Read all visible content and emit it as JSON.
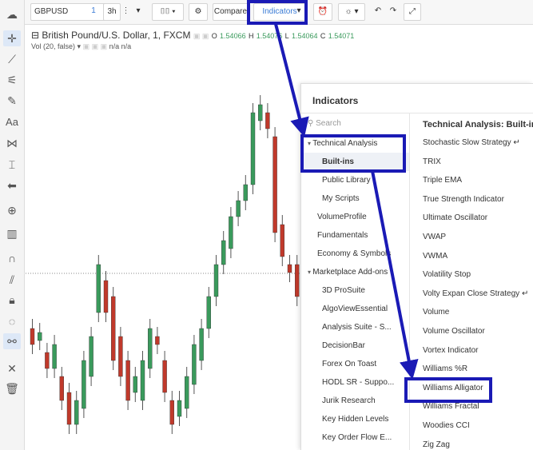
{
  "toolbar": {
    "symbol": "GBPUSD",
    "interval_1": "1",
    "interval_3h": "3h",
    "compare": "Compare",
    "indicators": "Indicators"
  },
  "chart": {
    "legend_title": "British Pound/U.S. Dollar, 1, FXCM",
    "o_label": "O",
    "o_value": "1.54066",
    "h_label": "H",
    "h_value": "1.54076",
    "l_label": "L",
    "l_value": "1.54064",
    "c_label": "C",
    "c_value": "1.54071",
    "vol_label": "Vol (20, false)",
    "vol_values": "n/a n/a",
    "colors": {
      "up": "#3a9a5c",
      "down": "#c0392b"
    }
  },
  "panel": {
    "title": "Indicators",
    "search_placeholder": "Search",
    "categories": [
      {
        "label": "Technical Analysis",
        "expandable": true
      },
      {
        "label": "Built-ins",
        "selected": true,
        "sub": true
      },
      {
        "label": "Public Library",
        "sub": true
      },
      {
        "label": "My Scripts",
        "sub": true
      },
      {
        "label": "VolumeProfile"
      },
      {
        "label": "Fundamentals"
      },
      {
        "label": "Economy & Symbols"
      },
      {
        "label": "Marketplace Add-ons",
        "expandable": true
      },
      {
        "label": "3D ProSuite",
        "sub": true
      },
      {
        "label": "AlgoViewEssential",
        "sub": true
      },
      {
        "label": "Analysis Suite - S...",
        "sub": true
      },
      {
        "label": "DecisionBar",
        "sub": true
      },
      {
        "label": "Forex On Toast",
        "sub": true
      },
      {
        "label": "HODL SR - Suppo...",
        "sub": true
      },
      {
        "label": "Jurik Research",
        "sub": true
      },
      {
        "label": "Key Hidden Levels",
        "sub": true
      },
      {
        "label": "Key Order Flow E...",
        "sub": true
      }
    ],
    "list_header": "Technical Analysis: Built-ins",
    "items": [
      "Stochastic Slow Strategy ↵",
      "TRIX",
      "Triple EMA",
      "True Strength Indicator",
      "Ultimate Oscillator",
      "VWAP",
      "VWMA",
      "Volatility Stop",
      "Volty Expan Close Strategy ↵",
      "Volume",
      "Volume Oscillator",
      "Vortex Indicator",
      "Williams %R",
      "Williams Alligator",
      "Williams Fractal",
      "Woodies CCI",
      "Zig Zag"
    ]
  }
}
